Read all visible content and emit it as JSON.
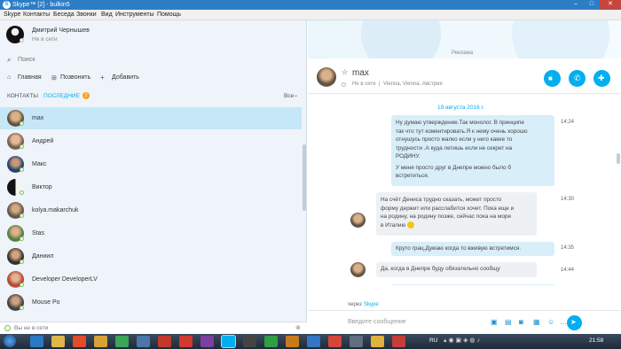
{
  "window": {
    "title": "Skype™ [2] - bulkin5",
    "minimize": "–",
    "maximize": "□",
    "close": "✕"
  },
  "menu": [
    "Skype",
    "Контакты",
    "Беседа",
    "Звонки",
    "Вид",
    "Инструменты",
    "Помощь"
  ],
  "profile": {
    "name": "Дмитрий Чернышев",
    "status": "Не в сети"
  },
  "search": {
    "placeholder": "Поиск"
  },
  "actions": {
    "home": "Главная",
    "call": "Позвонить",
    "add": "Добавить"
  },
  "contacts_tabs": {
    "contacts": "КОНТАКТЫ",
    "recent": "ПОСЛЕДНИЕ",
    "recent_badge": "2",
    "filter": "Все"
  },
  "contacts": [
    {
      "name": "max"
    },
    {
      "name": "Андрей"
    },
    {
      "name": "Макс"
    },
    {
      "name": "Виктор"
    },
    {
      "name": "kolya.makarchuk"
    },
    {
      "name": "Stas"
    },
    {
      "name": "Даниил"
    },
    {
      "name": "Developer DeveloperLV"
    },
    {
      "name": "Mouse Po"
    }
  ],
  "bottom_status": "Вы не в сети",
  "ad_label": "Реклама",
  "chat": {
    "name": "max",
    "status": "Не в сети",
    "location": "Vienna, Vienna, Австрия",
    "date": "19 августа 2016 г.",
    "messages": [
      {
        "dir": "out",
        "time": "14:24",
        "lines": [
          "Ну думаю утверждение.Так монолог. В принципе",
          "так что тут коментировать.Я к нему очень хорошо",
          "отнушусь просто жалко если у него какие то",
          "трудности .А куда летишь если не секрет на",
          "РОДИНУ."
        ],
        "extra": [
          "У меня просто друг в Днепре можно было б",
          "встретиться."
        ]
      },
      {
        "dir": "in",
        "time": "14:30",
        "lines": [
          "На счёт Дениса трудно сказать, может просто",
          "форму держит или расслабится хочет. Пока еще и",
          "на родину, на родину позже, сейчас пока на море",
          "в Италию"
        ]
      },
      {
        "dir": "out",
        "time": "14:35",
        "lines": [
          "Круто грац.Думаю когда то вживую встретимся."
        ]
      },
      {
        "dir": "in",
        "time": "14:44",
        "lines": [
          "Да, когда в Днепре буду обязательно сообщу"
        ]
      }
    ],
    "via_prefix": "через",
    "via_link": "Skype",
    "input_placeholder": "Введите сообщение"
  },
  "taskbar": {
    "lang": "RU",
    "time": "21:58"
  },
  "colors": {
    "accent": "#00aff0",
    "titlebar": "#2d7dc4",
    "online": "#7ac143",
    "badge": "#f7a21b"
  }
}
